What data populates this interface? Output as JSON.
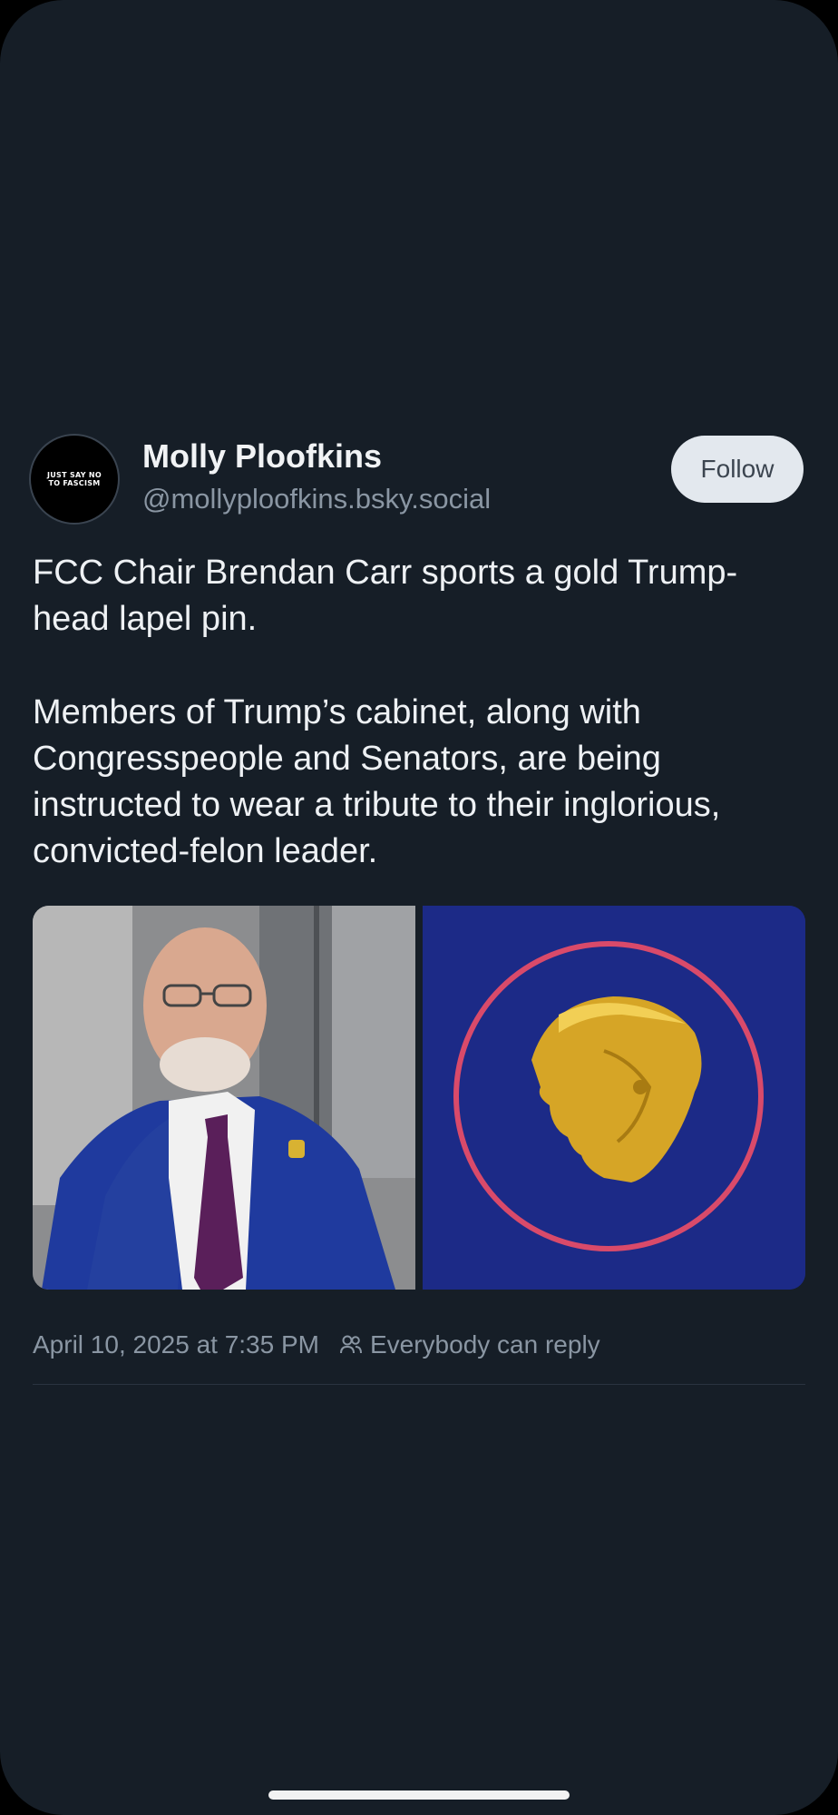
{
  "post": {
    "author": {
      "display_name": "Molly Ploofkins",
      "handle": "@mollyploofkins.bsky.social",
      "avatar_text_line1": "JUST SAY NO",
      "avatar_text_line2": "TO FASCISM"
    },
    "follow_label": "Follow",
    "paragraphs": [
      "FCC Chair Brendan Carr sports a gold Trump-head lapel pin.",
      "Members of Trump’s cabinet, along with Congresspeople and Senators, are being instructed to wear a tribute to their inglorious, convicted-felon leader."
    ],
    "timestamp": "April 10, 2025 at 7:35 PM",
    "reply_setting": "Everybody can reply",
    "reply_icon": "people-icon"
  },
  "colors": {
    "background": "#161e27",
    "text": "#eef1f4",
    "muted": "#8a96a3",
    "follow_button": "#e3e8ee"
  }
}
